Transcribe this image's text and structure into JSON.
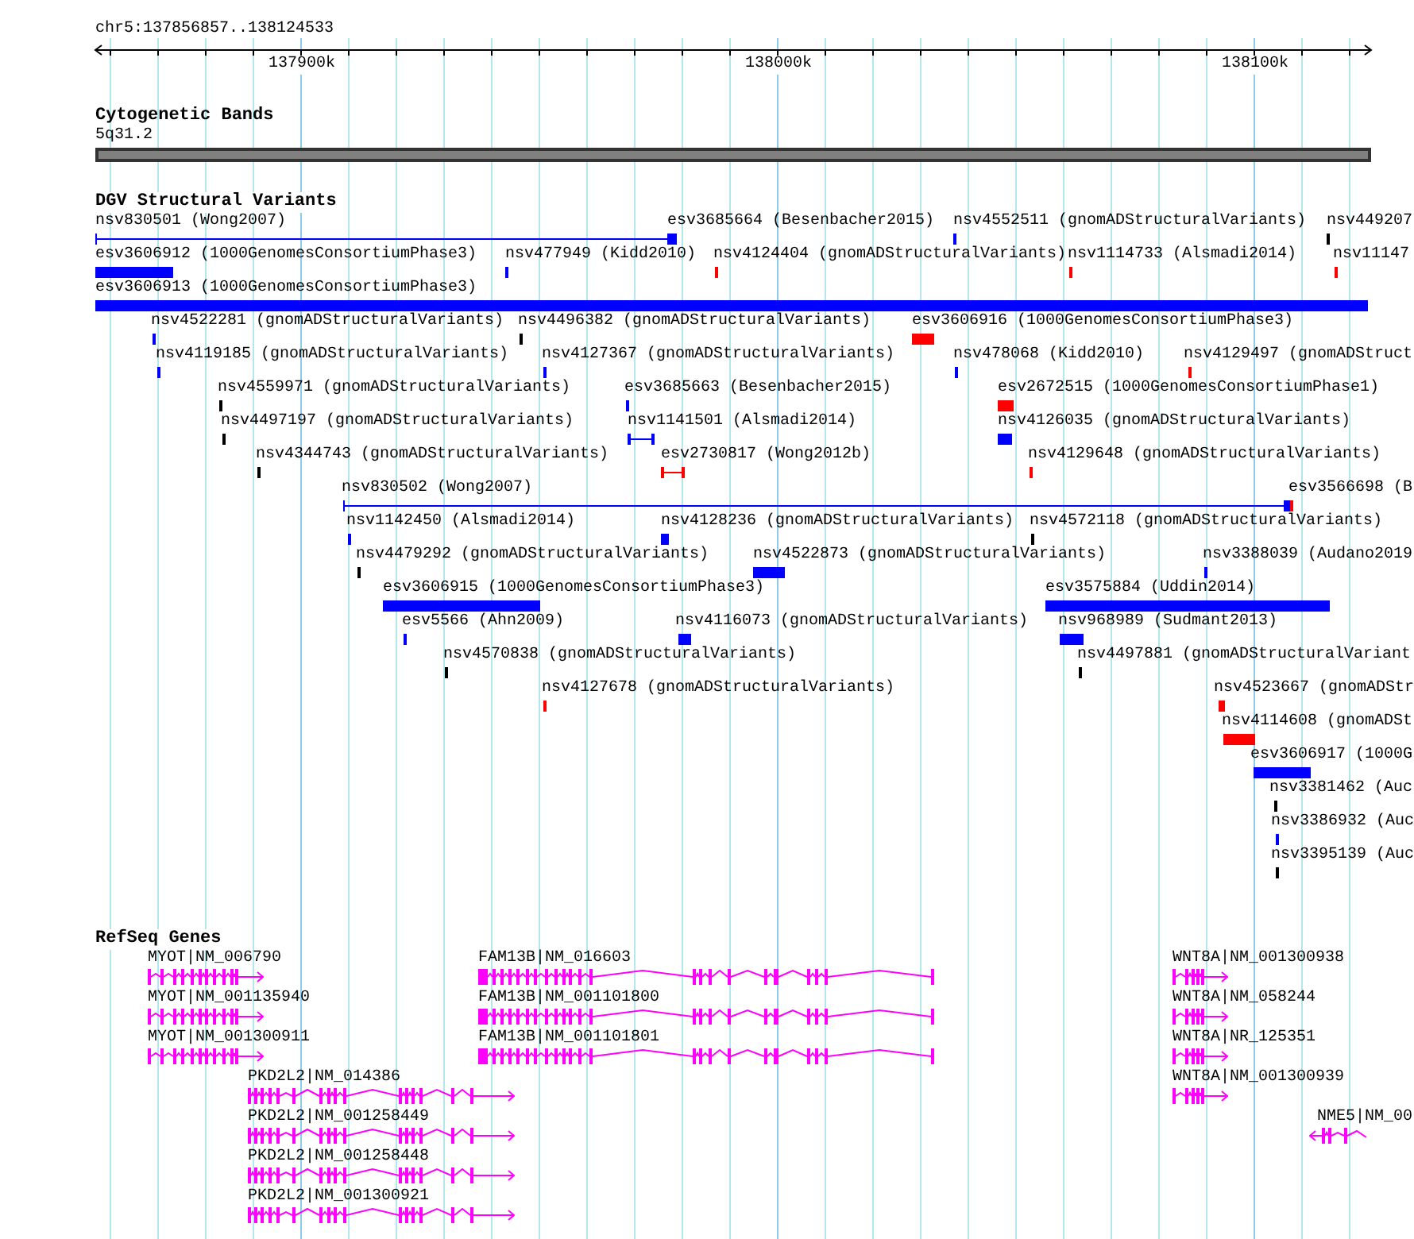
{
  "ruler": {
    "location": "chr5:137856857..138124533",
    "ticks": [
      "137900k",
      "138000k",
      "138100k"
    ]
  },
  "cytogenetic_track": {
    "title": "Cytogenetic Bands",
    "band": "5q31.2"
  },
  "dgv_track": {
    "title": "DGV Structural Variants",
    "features": [
      {
        "label": "nsv830501 (Wong2007)",
        "color": "#0000ff",
        "kind": "line"
      },
      {
        "label": "esv3685664 (Besenbacher2015)"
      },
      {
        "label": "nsv4552511 (gnomADStructuralVariants)",
        "color": "#0000ff",
        "kind": "tick"
      },
      {
        "label": "nsv449207",
        "color": "#000000",
        "kind": "tick"
      },
      {
        "label": "esv3606912 (1000GenomesConsortiumPhase3)",
        "color": "#0000ff",
        "kind": "bar"
      },
      {
        "label": "nsv477949 (Kidd2010)",
        "color": "#0000ff",
        "kind": "tick"
      },
      {
        "label": "nsv4124404 (gnomADStructuralVariants)",
        "color": "#ff0000",
        "kind": "tick"
      },
      {
        "label": "nsv1114733 (Alsmadi2014)",
        "color": "#ff0000",
        "kind": "tick"
      },
      {
        "label": "nsv11147",
        "color": "#ff0000",
        "kind": "tick"
      },
      {
        "label": "esv3606913 (1000GenomesConsortiumPhase3)",
        "color": "#0000ff",
        "kind": "bar"
      },
      {
        "label": "nsv4522281 (gnomADStructuralVariants)",
        "color": "#0000ff",
        "kind": "tick"
      },
      {
        "label": "nsv4496382 (gnomADStructuralVariants)",
        "color": "#000000",
        "kind": "tick"
      },
      {
        "label": "esv3606916 (1000GenomesConsortiumPhase3)",
        "color": "#ff0000",
        "kind": "bar"
      },
      {
        "label": "nsv4119185 (gnomADStructuralVariants)",
        "color": "#0000ff",
        "kind": "tick"
      },
      {
        "label": "nsv4127367 (gnomADStructuralVariants)",
        "color": "#0000ff",
        "kind": "tick"
      },
      {
        "label": "nsv478068 (Kidd2010)",
        "color": "#0000ff",
        "kind": "tick"
      },
      {
        "label": "nsv4129497 (gnomADStruct",
        "color": "#ff0000",
        "kind": "tick"
      },
      {
        "label": "nsv4559971 (gnomADStructuralVariants)",
        "color": "#000000",
        "kind": "tick"
      },
      {
        "label": "esv3685663 (Besenbacher2015)",
        "color": "#0000ff",
        "kind": "tick"
      },
      {
        "label": "esv2672515 (1000GenomesConsortiumPhase1)",
        "color": "#ff0000",
        "kind": "bar"
      },
      {
        "label": "nsv4497197 (gnomADStructuralVariants)",
        "color": "#000000",
        "kind": "tick"
      },
      {
        "label": "nsv1141501 (Alsmadi2014)",
        "color": "#0000ff",
        "kind": "span"
      },
      {
        "label": "nsv4126035 (gnomADStructuralVariants)",
        "color": "#0000ff",
        "kind": "bar"
      },
      {
        "label": "nsv4344743 (gnomADStructuralVariants)",
        "color": "#000000",
        "kind": "tick"
      },
      {
        "label": "esv2730817 (Wong2012b)",
        "color": "#ff0000",
        "kind": "span"
      },
      {
        "label": "nsv4129648 (gnomADStructuralVariants)",
        "color": "#ff0000",
        "kind": "tick"
      },
      {
        "label": "nsv830502 (Wong2007)",
        "color": "#0000ff",
        "kind": "line"
      },
      {
        "label": "esv3566698 (B",
        "color": "#ff0000",
        "kind": "tick"
      },
      {
        "label": "nsv1142450 (Alsmadi2014)",
        "color": "#0000ff",
        "kind": "tick"
      },
      {
        "label": "nsv4128236 (gnomADStructuralVariants)",
        "color": "#0000ff",
        "kind": "bar"
      },
      {
        "label": "nsv4572118 (gnomADStructuralVariants)",
        "color": "#000000",
        "kind": "tick"
      },
      {
        "label": "nsv4479292 (gnomADStructuralVariants)",
        "color": "#000000",
        "kind": "tick"
      },
      {
        "label": "nsv4522873 (gnomADStructuralVariants)",
        "color": "#0000ff",
        "kind": "bar"
      },
      {
        "label": "nsv3388039 (Audano2019",
        "color": "#0000ff",
        "kind": "tick"
      },
      {
        "label": "esv3606915 (1000GenomesConsortiumPhase3)",
        "color": "#0000ff",
        "kind": "bar"
      },
      {
        "label": "esv3575884 (Uddin2014)",
        "color": "#0000ff",
        "kind": "bar"
      },
      {
        "label": "esv5566 (Ahn2009)",
        "color": "#0000ff",
        "kind": "tick"
      },
      {
        "label": "nsv4116073 (gnomADStructuralVariants)",
        "color": "#0000ff",
        "kind": "bar"
      },
      {
        "label": "nsv968989 (Sudmant2013)",
        "color": "#0000ff",
        "kind": "bar"
      },
      {
        "label": "nsv4570838 (gnomADStructuralVariants)",
        "color": "#000000",
        "kind": "tick"
      },
      {
        "label": "nsv4497881 (gnomADStructuralVariant",
        "color": "#000000",
        "kind": "tick"
      },
      {
        "label": "nsv4127678 (gnomADStructuralVariants)",
        "color": "#ff0000",
        "kind": "tick"
      },
      {
        "label": "nsv4523667 (gnomADStr",
        "color": "#ff0000",
        "kind": "bar"
      },
      {
        "label": "nsv4114608 (gnomADSt",
        "color": "#ff0000",
        "kind": "bar"
      },
      {
        "label": "esv3606917 (1000G",
        "color": "#0000ff",
        "kind": "bar"
      },
      {
        "label": "nsv3381462 (Auc",
        "color": "#000000",
        "kind": "tick"
      },
      {
        "label": "nsv3386932 (Auc",
        "color": "#0000ff",
        "kind": "tick"
      },
      {
        "label": "nsv3395139 (Auc",
        "color": "#000000",
        "kind": "tick"
      }
    ]
  },
  "refseq_track": {
    "title": "RefSeq Genes",
    "genes": [
      {
        "label": "MYOT|NM_006790",
        "kind": "forward"
      },
      {
        "label": "FAM13B|NM_016603",
        "kind": "plain"
      },
      {
        "label": "WNT8A|NM_001300938",
        "kind": "forward"
      },
      {
        "label": "MYOT|NM_001135940",
        "kind": "forward"
      },
      {
        "label": "FAM13B|NM_001101800",
        "kind": "plain"
      },
      {
        "label": "WNT8A|NM_058244",
        "kind": "forward"
      },
      {
        "label": "MYOT|NM_001300911",
        "kind": "forward"
      },
      {
        "label": "FAM13B|NM_001101801",
        "kind": "plain"
      },
      {
        "label": "WNT8A|NR_125351",
        "kind": "forward"
      },
      {
        "label": "PKD2L2|NM_014386",
        "kind": "forward"
      },
      {
        "label": "WNT8A|NM_001300939",
        "kind": "forward"
      },
      {
        "label": "PKD2L2|NM_001258449",
        "kind": "forward"
      },
      {
        "label": "NME5|NM_00",
        "kind": "reverse"
      },
      {
        "label": "PKD2L2|NM_001258448",
        "kind": "forward"
      },
      {
        "label": "PKD2L2|NM_001300921",
        "kind": "forward"
      }
    ]
  }
}
